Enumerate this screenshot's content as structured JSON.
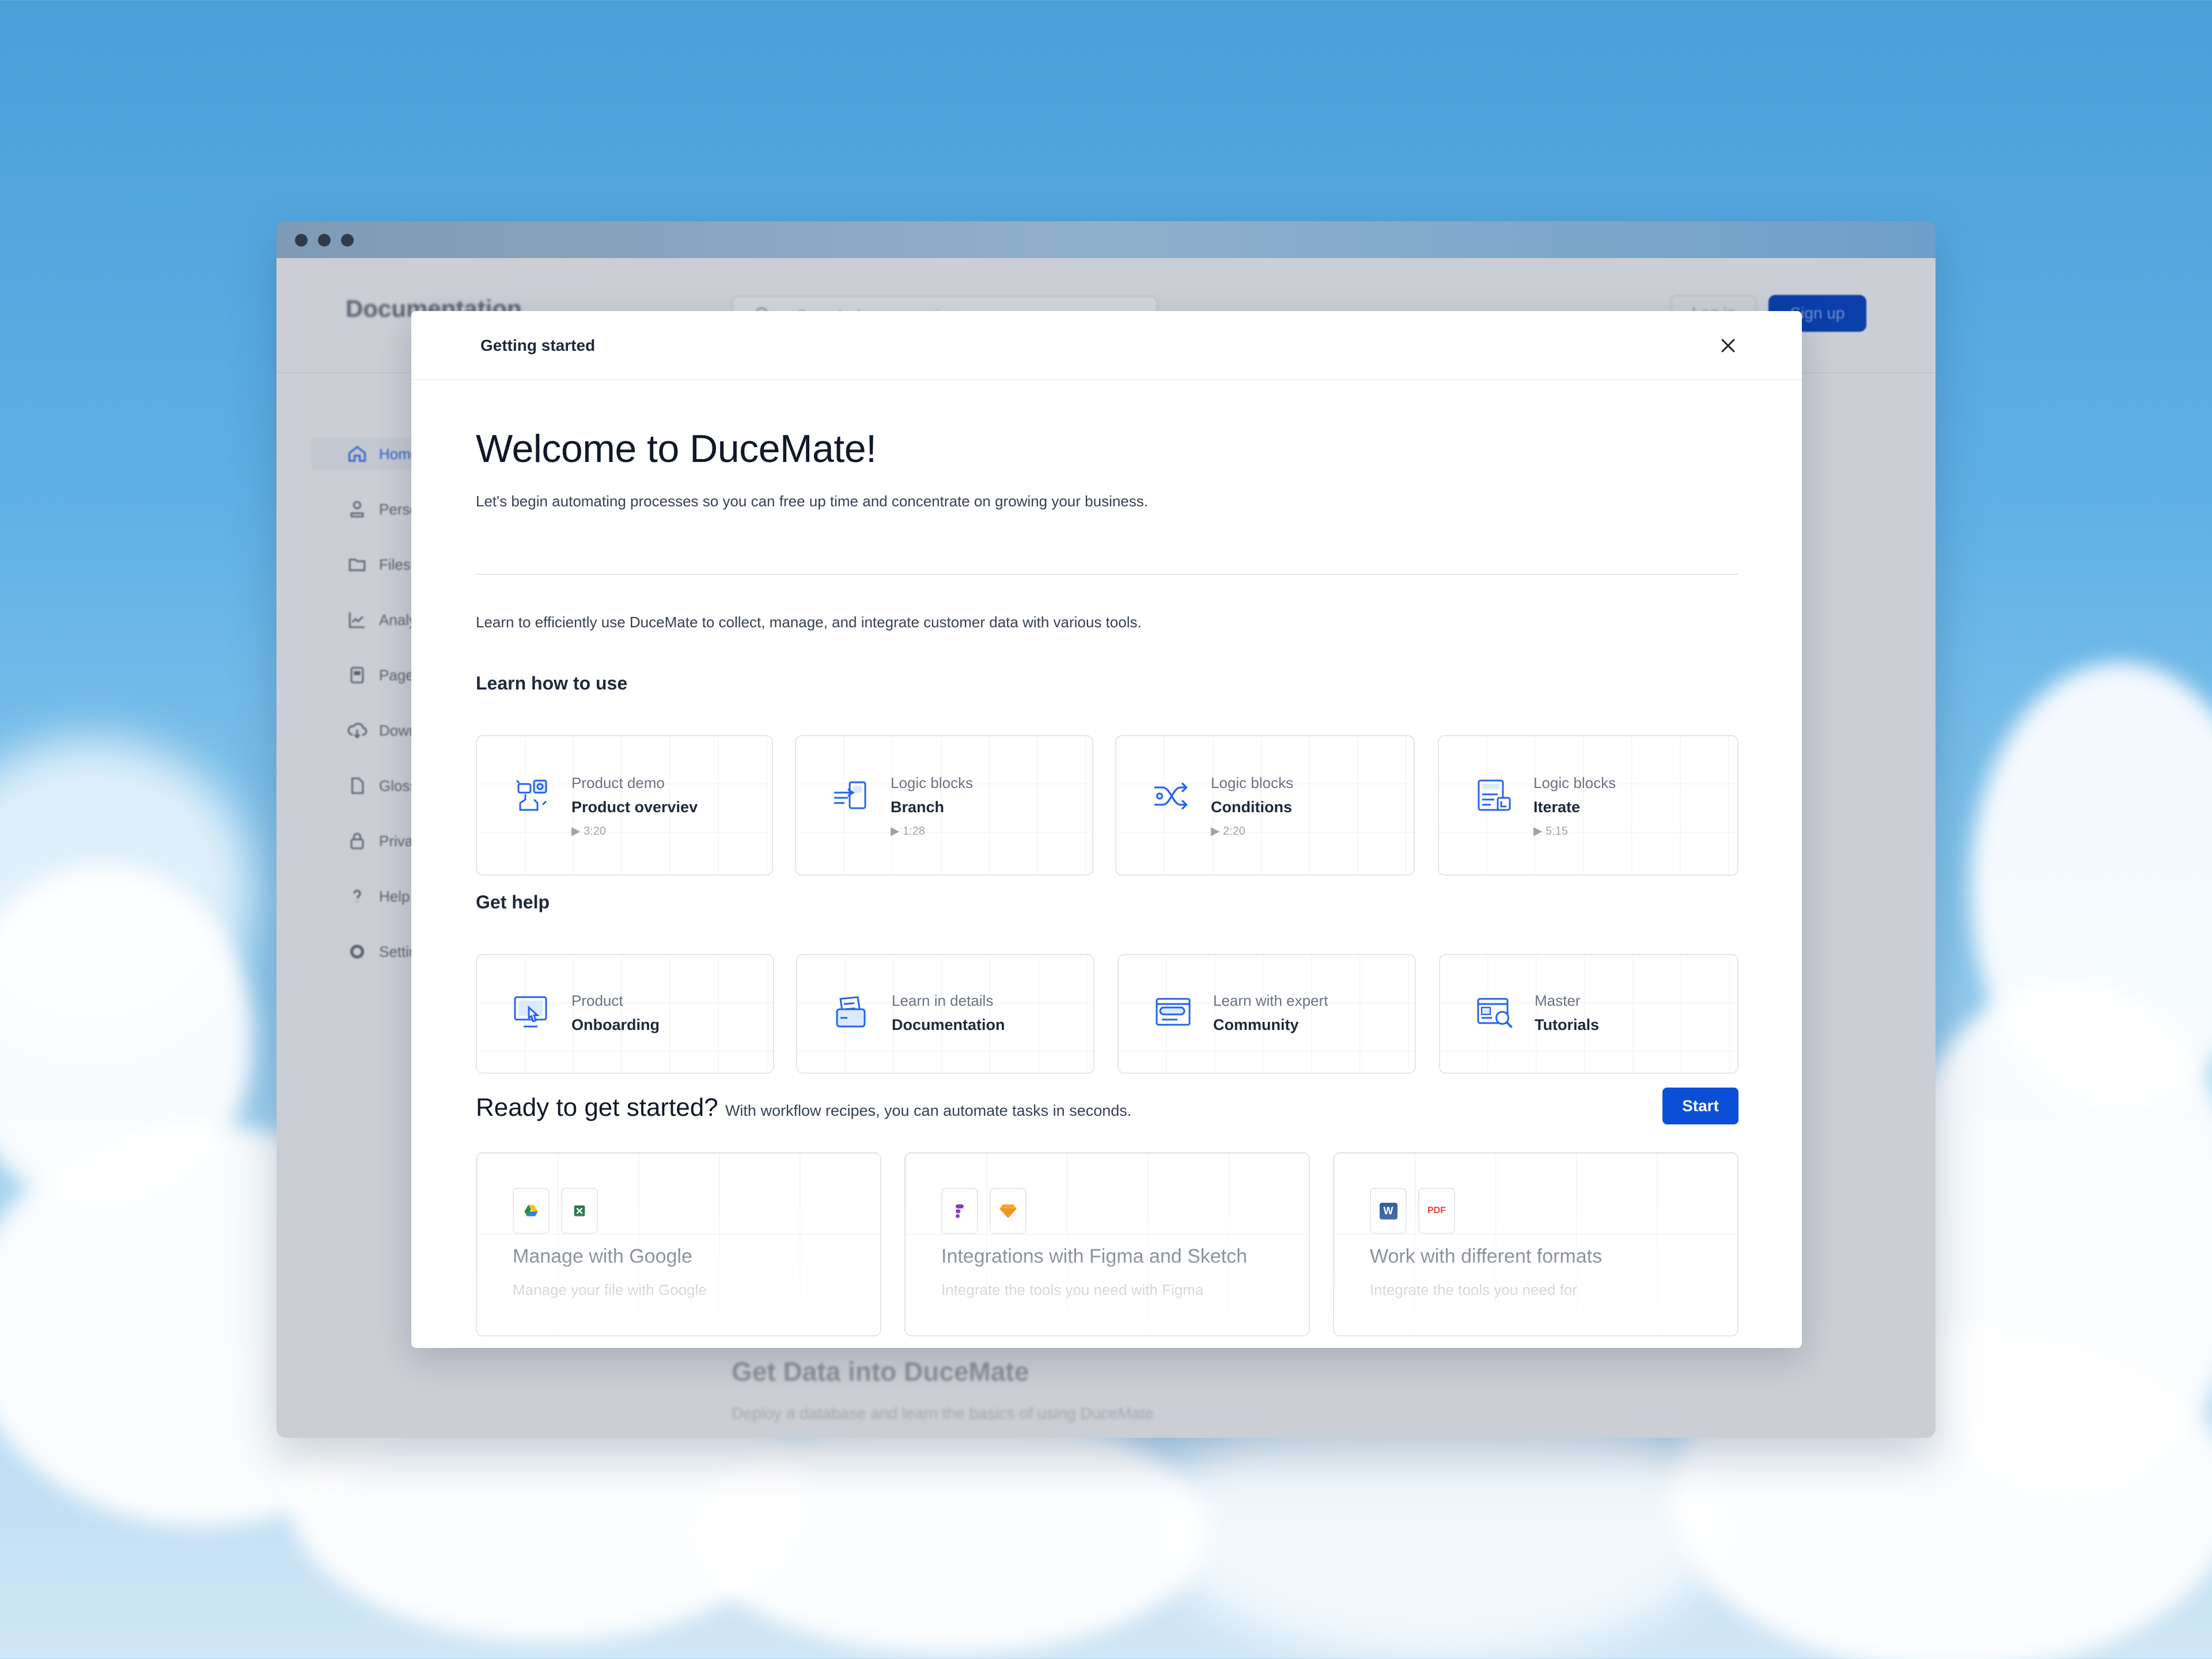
{
  "background_app": {
    "brand": "Documentation",
    "search_placeholder": "Search documentation",
    "login_label": "Log in",
    "signup_label": "Sign up",
    "sidebar": [
      {
        "label": "Home",
        "icon": "home-icon"
      },
      {
        "label": "Personal",
        "icon": "user-icon"
      },
      {
        "label": "Files",
        "icon": "folder-icon"
      },
      {
        "label": "Analytics",
        "icon": "chart-icon"
      },
      {
        "label": "Pages",
        "icon": "page-icon"
      },
      {
        "label": "Downloads",
        "icon": "cloud-download-icon"
      },
      {
        "label": "Glossary",
        "icon": "document-icon"
      },
      {
        "label": "Privacy",
        "icon": "lock-icon"
      },
      {
        "label": "Help",
        "icon": "question-icon"
      },
      {
        "label": "Settings",
        "icon": "gear-icon"
      }
    ],
    "section_title": "Get Data into DuceMate",
    "section_sub": "Deploy a database and learn the basics of using DuceMate"
  },
  "modal": {
    "header_title": "Getting started",
    "welcome_title": "Welcome to DuceMate!",
    "intro": "Let's begin automating processes so you can free up time and concentrate on growing your business.",
    "learn_description": "Learn to efficiently use DuceMate to collect, manage, and integrate customer data with various tools.",
    "learn_section": "Learn how to use",
    "learn_cards": [
      {
        "small": "Product demo",
        "title": "Product overviev",
        "duration": "▶ 3:20",
        "icon": "product-demo-icon"
      },
      {
        "small": "Logic blocks",
        "title": "Branch",
        "duration": "▶ 1:28",
        "icon": "branch-icon"
      },
      {
        "small": "Logic blocks",
        "title": "Conditions",
        "duration": "▶ 2:20",
        "icon": "conditions-icon"
      },
      {
        "small": "Logic blocks",
        "title": "Iterate",
        "duration": "▶ 5:15",
        "icon": "iterate-icon"
      }
    ],
    "help_section": "Get help",
    "help_cards": [
      {
        "small": "Product",
        "title": "Onboarding",
        "icon": "onboarding-icon"
      },
      {
        "small": "Learn in details",
        "title": "Documentation",
        "icon": "documentation-icon"
      },
      {
        "small": "Learn with expert",
        "title": "Community",
        "icon": "community-icon"
      },
      {
        "small": "Master",
        "title": "Tutorials",
        "icon": "tutorials-icon"
      }
    ],
    "ready_title": "Ready to get started?",
    "ready_sub": "With workflow recipes, you can automate tasks in seconds.",
    "start_label": "Start",
    "recipes": [
      {
        "title": "Manage with Google",
        "description": "Manage your file with Google",
        "icons": [
          "google-drive-icon",
          "excel-icon"
        ]
      },
      {
        "title": "Integrations with Figma and Sketch",
        "description": "Integrate the tools you need with Figma",
        "icons": [
          "figma-icon",
          "sketch-icon"
        ]
      },
      {
        "title": "Work with different formats",
        "description": "Integrate the tools you need for",
        "icons": [
          "word-icon",
          "pdf-icon"
        ],
        "pdf_label": "PDF",
        "word_label": "W"
      }
    ]
  },
  "colors": {
    "accent": "#0b4fd6",
    "icon_blue": "#2563eb",
    "text_dark": "#111827"
  }
}
